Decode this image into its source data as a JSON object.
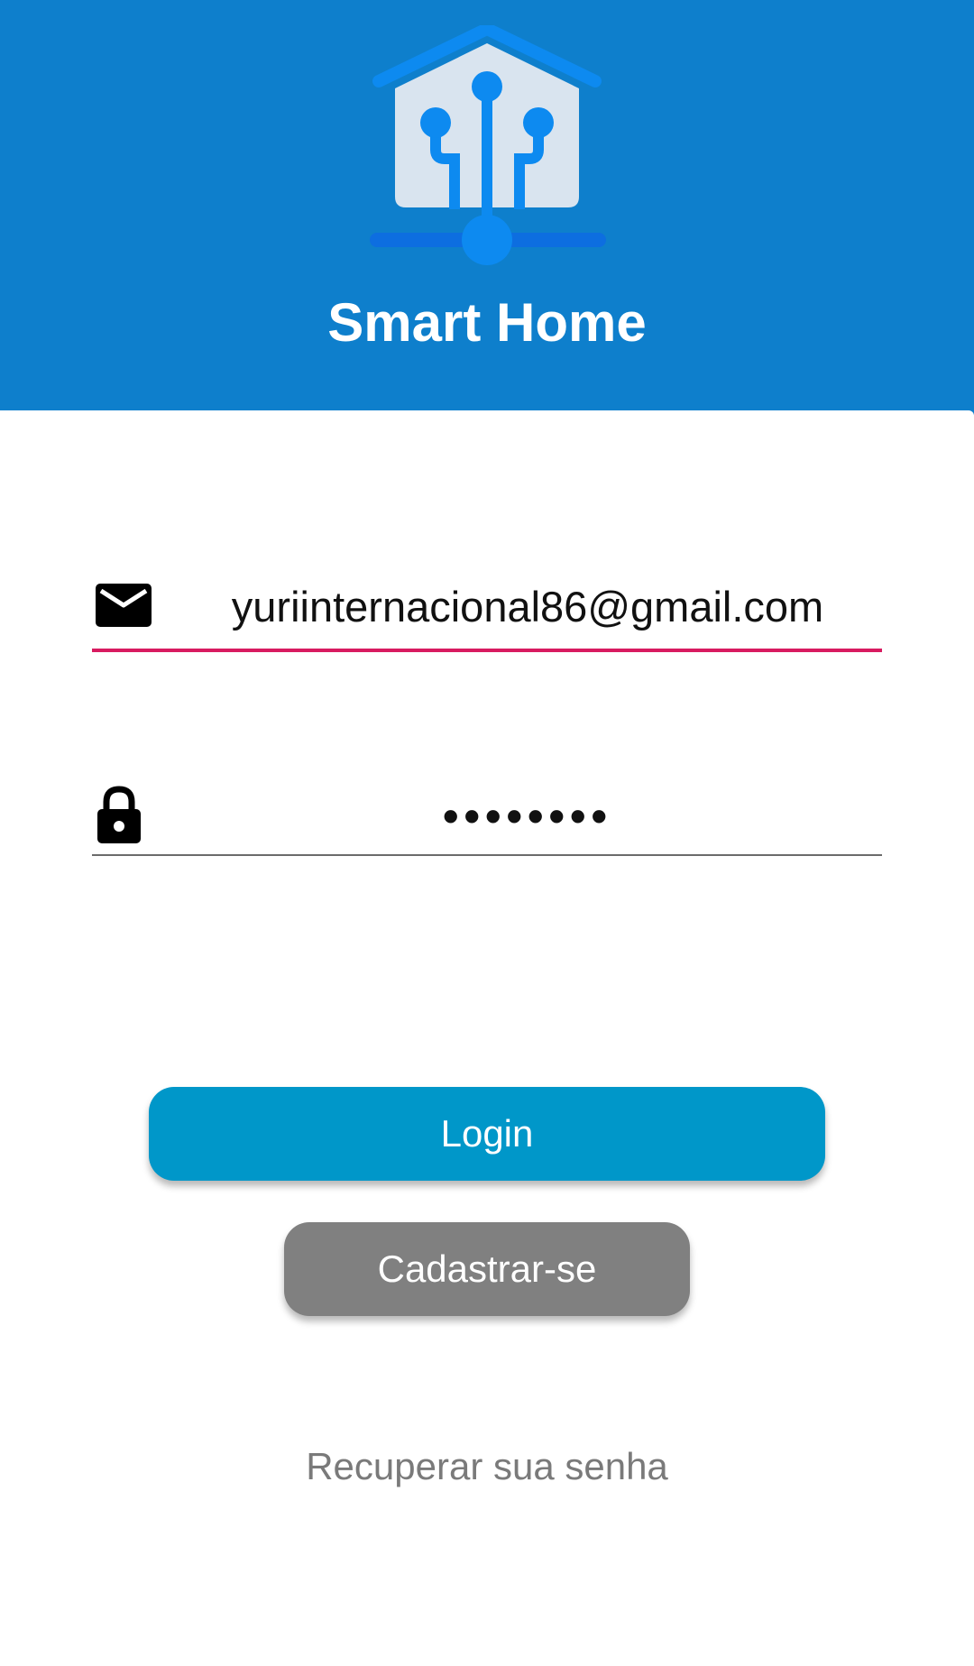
{
  "app": {
    "title": "Smart Home",
    "logo_icon": "smart-home-logo-icon"
  },
  "login_form": {
    "email_icon": "envelope-icon",
    "email_value": "yuriinternacional86@gmail.com",
    "password_icon": "lock-icon",
    "password_value": "••••••••"
  },
  "buttons": {
    "login_label": "Login",
    "register_label": "Cadastrar-se"
  },
  "links": {
    "recover_password": "Recuperar sua senha"
  },
  "colors": {
    "header_background": "#0e7fcc",
    "login_button": "#0097c9",
    "register_button": "#808080",
    "email_underline_active": "#d81b60"
  }
}
